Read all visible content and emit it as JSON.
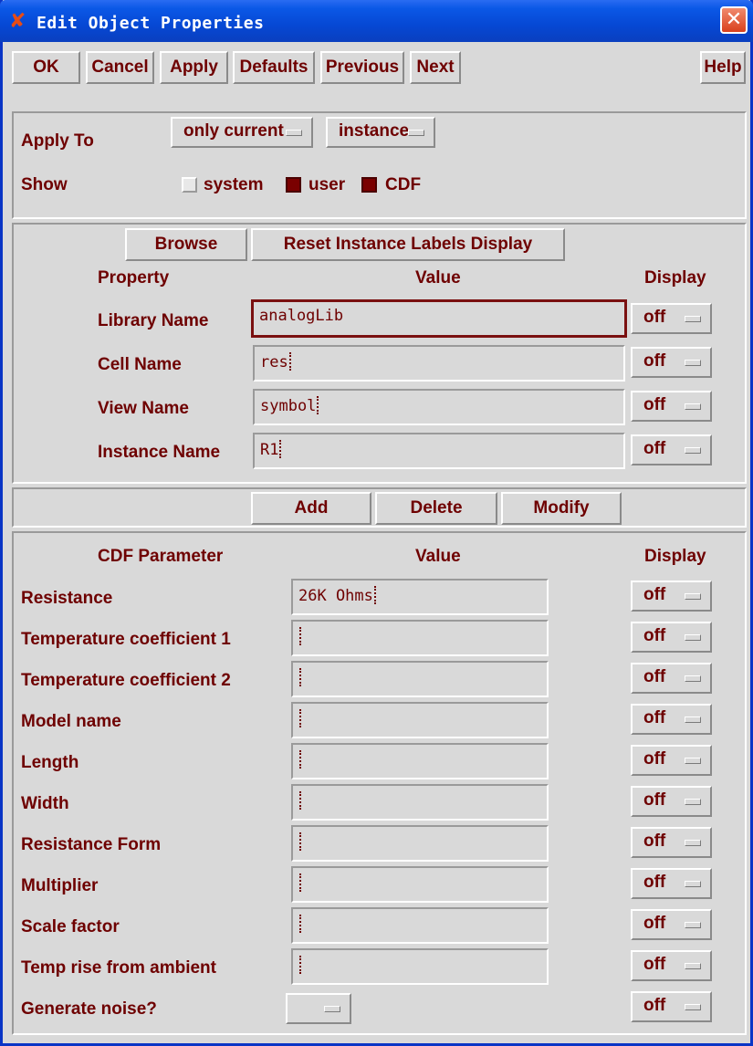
{
  "window": {
    "title": "Edit Object Properties",
    "close_glyph": "✕",
    "title_icon_glyph": "✘"
  },
  "toolbar": {
    "ok": "OK",
    "cancel": "Cancel",
    "apply": "Apply",
    "defaults": "Defaults",
    "previous": "Previous",
    "next": "Next",
    "help": "Help"
  },
  "apply_to": {
    "label": "Apply To",
    "scope_value": "only current",
    "type_value": "instance"
  },
  "show": {
    "label": "Show",
    "system": "system",
    "user": "user",
    "cdf": "CDF",
    "system_checked": false,
    "user_checked": true,
    "cdf_checked": true
  },
  "properties": {
    "browse": "Browse",
    "reset_labels": "Reset Instance Labels Display",
    "col_property": "Property",
    "col_value": "Value",
    "col_display": "Display",
    "rows": [
      {
        "name": "Library Name",
        "value": "analogLib",
        "display": "off"
      },
      {
        "name": "Cell Name",
        "value": "res",
        "display": "off"
      },
      {
        "name": "View Name",
        "value": "symbol",
        "display": "off"
      },
      {
        "name": "Instance Name",
        "value": "R1",
        "display": "off"
      }
    ]
  },
  "actions": {
    "add": "Add",
    "delete": "Delete",
    "modify": "Modify"
  },
  "cdf": {
    "col_param": "CDF Parameter",
    "col_value": "Value",
    "col_display": "Display",
    "rows": [
      {
        "name": "Resistance",
        "value": "26K Ohms",
        "display": "off"
      },
      {
        "name": "Temperature coefficient 1",
        "value": "",
        "display": "off"
      },
      {
        "name": "Temperature coefficient 2",
        "value": "",
        "display": "off"
      },
      {
        "name": "Model name",
        "value": "",
        "display": "off"
      },
      {
        "name": "Length",
        "value": "",
        "display": "off"
      },
      {
        "name": "Width",
        "value": "",
        "display": "off"
      },
      {
        "name": "Resistance Form",
        "value": "",
        "display": "off"
      },
      {
        "name": "Multiplier",
        "value": "",
        "display": "off"
      },
      {
        "name": "Scale factor",
        "value": "",
        "display": "off"
      },
      {
        "name": "Temp rise from ambient",
        "value": "",
        "display": "off"
      },
      {
        "name": "Generate noise?",
        "value": "",
        "display": "off"
      }
    ]
  }
}
